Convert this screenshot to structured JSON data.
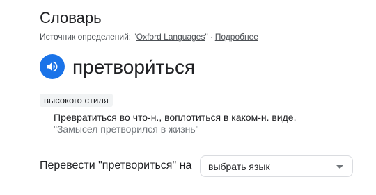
{
  "header": {
    "title": "Словарь",
    "source_prefix": "Источник определений: \"",
    "source_name": "Oxford Languages",
    "source_suffix": "\"",
    "separator": "·",
    "more_link": "Подробнее"
  },
  "entry": {
    "speaker_icon": "volume-icon",
    "accent_color": "#1a73e8",
    "word": "претвори́ться",
    "register_label": "высокого стиля",
    "definition": "Превратиться во что-н., воплотиться в каком-н. виде.",
    "example": "\"Замысел претворился в жизнь\""
  },
  "translate": {
    "label": "Перевести \"претвориться\" на",
    "select_value": "выбрать язык",
    "dropdown_icon": "caret-down-icon"
  }
}
